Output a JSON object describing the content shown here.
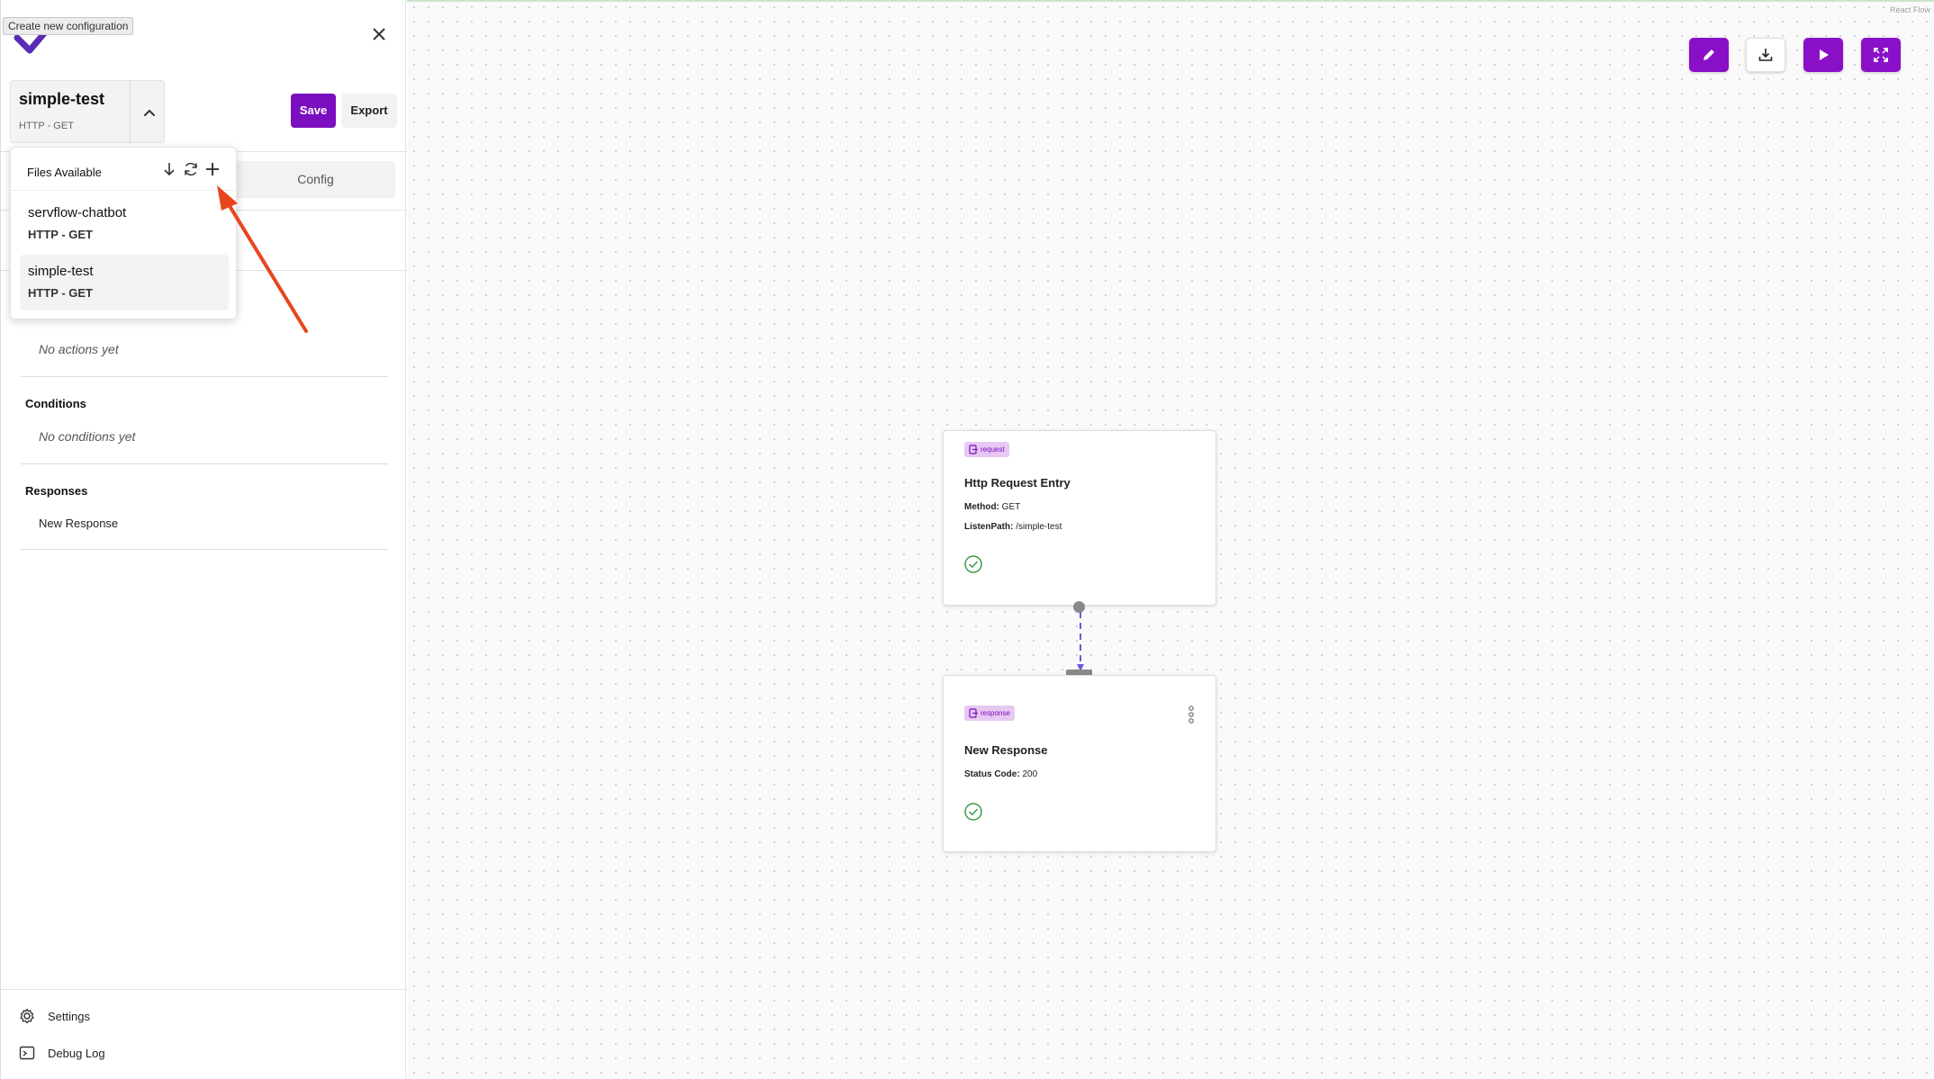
{
  "tooltip": "Create new configuration",
  "config": {
    "name": "simple-test",
    "type": "HTTP - GET"
  },
  "toolbar": {
    "save_label": "Save",
    "export_label": "Export"
  },
  "tabs": {
    "config_label": "Config"
  },
  "files_menu": {
    "header": "Files Available",
    "items": [
      {
        "name": "servflow-chatbot",
        "type": "HTTP - GET"
      },
      {
        "name": "simple-test",
        "type": "HTTP - GET",
        "selected": true
      }
    ]
  },
  "sections": {
    "actions_empty": "No actions yet",
    "conditions_title": "Conditions",
    "conditions_empty": "No conditions yet",
    "responses_title": "Responses",
    "responses_items": [
      "New Response"
    ]
  },
  "bottom_nav": {
    "settings": "Settings",
    "debug_log": "Debug Log"
  },
  "canvas": {
    "attribution": "React Flow",
    "nodes": [
      {
        "badge": "request",
        "title": "Http Request Entry",
        "props": [
          {
            "label": "Method:",
            "value": "GET"
          },
          {
            "label": "ListenPath:",
            "value": "/simple-test"
          }
        ]
      },
      {
        "badge": "response",
        "title": "New Response",
        "props": [
          {
            "label": "Status Code:",
            "value": "200"
          }
        ]
      }
    ]
  },
  "colors": {
    "accent": "#7b0fbf",
    "badge_bg": "#e7c8f3",
    "edge": "#6a5ae0",
    "annotation_arrow": "#e8451e",
    "check": "#3a9a4a"
  },
  "icons": [
    "logo-check-icon",
    "close-icon",
    "chevron-up-icon",
    "download-icon",
    "refresh-icon",
    "plus-icon",
    "gear-icon",
    "terminal-icon",
    "pencil-icon",
    "play-icon",
    "fullscreen-icon",
    "check-circle-icon",
    "more-vertical-icon"
  ]
}
